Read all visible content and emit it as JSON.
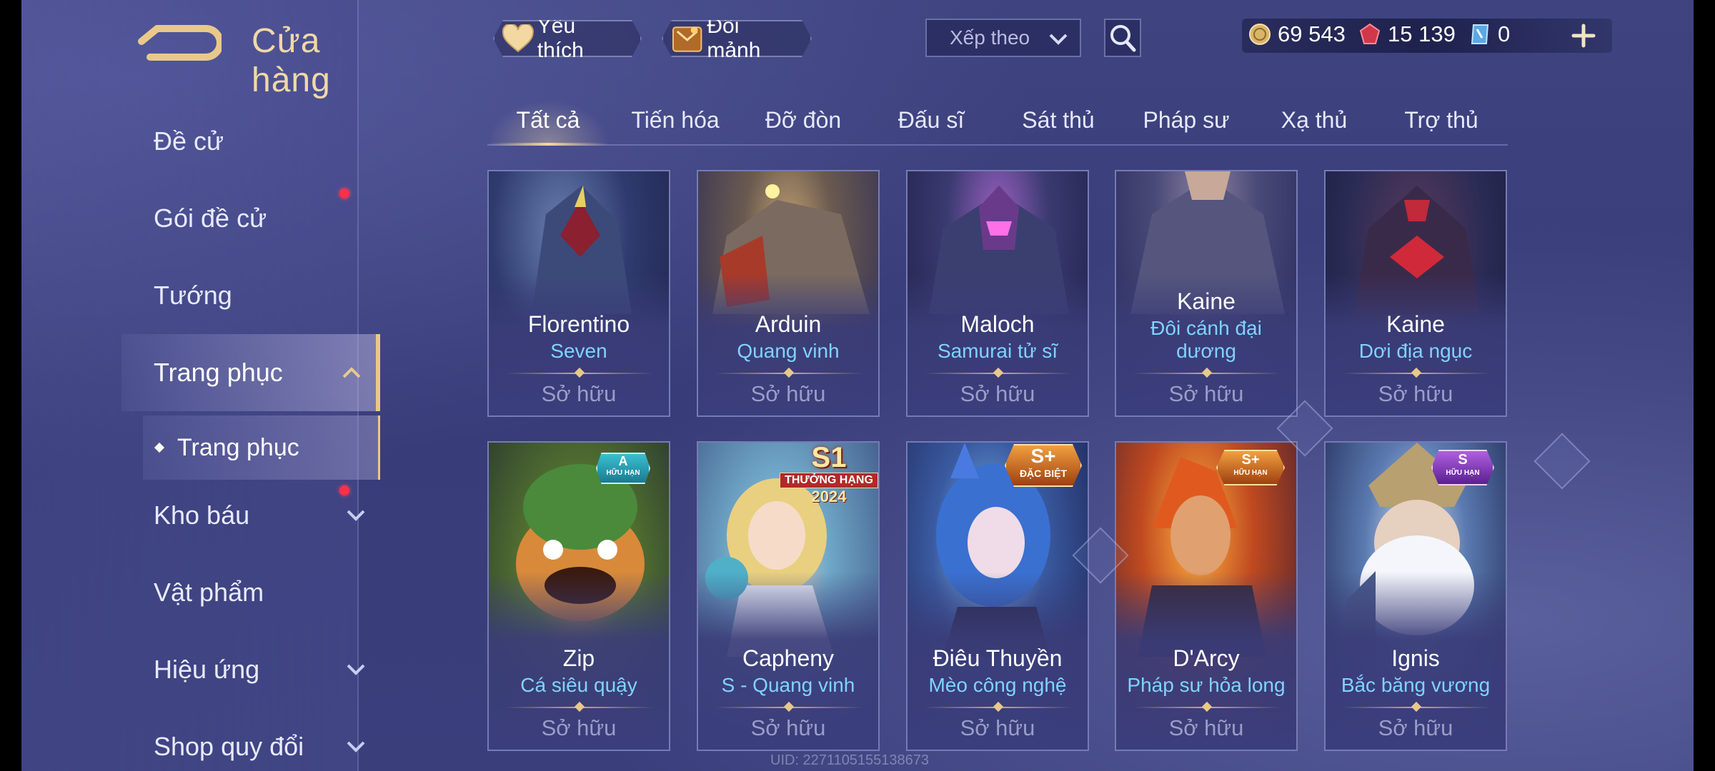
{
  "header": {
    "title": "Cửa hàng",
    "favorites_label": "Yêu thích",
    "exchange_label": "Đổi mảnh",
    "sort_label": "Xếp theo"
  },
  "currency": {
    "gold": "69 543",
    "gems": "15 139",
    "vouchers": "0"
  },
  "sidebar": {
    "items": [
      {
        "label": "Đề cử"
      },
      {
        "label": "Gói đề cử"
      },
      {
        "label": "Tướng"
      },
      {
        "label": "Trang phục"
      },
      {
        "label": "Kho báu"
      },
      {
        "label": "Vật phẩm"
      },
      {
        "label": "Hiệu ứng"
      },
      {
        "label": "Shop quy đổi"
      }
    ],
    "sub_item": "Trang phục"
  },
  "tabs": [
    "Tất cả",
    "Tiến hóa",
    "Đỡ đòn",
    "Đấu sĩ",
    "Sát thủ",
    "Pháp sư",
    "Xạ thủ",
    "Trợ thủ"
  ],
  "cards": [
    {
      "hero": "Florentino",
      "skin": "Seven",
      "status": "Sở hữu",
      "badge": ""
    },
    {
      "hero": "Arduin",
      "skin": "Quang vinh",
      "status": "Sở hữu",
      "badge": ""
    },
    {
      "hero": "Maloch",
      "skin": "Samurai tử sĩ",
      "status": "Sở hữu",
      "badge": ""
    },
    {
      "hero": "Kaine",
      "skin": "Đôi cánh đại dương",
      "skin_line1": "Đôi cánh đại",
      "skin_line2": "dương",
      "status": "Sở hữu",
      "badge": ""
    },
    {
      "hero": "Kaine",
      "skin": "Dơi địa ngục",
      "status": "Sở hữu",
      "badge": ""
    },
    {
      "hero": "Zip",
      "skin": "Cá siêu quậy",
      "status": "Sở hữu",
      "badge": "A",
      "badge_sub": "HỮU HẠN"
    },
    {
      "hero": "Capheny",
      "skin": "S - Quang vinh",
      "status": "Sở hữu",
      "badge": "S1",
      "badge_sub": "THƯỞNG HẠNG",
      "badge_year": "2024"
    },
    {
      "hero": "Điêu Thuyền",
      "skin": "Mèo công nghệ",
      "status": "Sở hữu",
      "badge": "S+",
      "badge_sub": "ĐẶC BIỆT"
    },
    {
      "hero": "D'Arcy",
      "skin": "Pháp sư hỏa long",
      "status": "Sở hữu",
      "badge": "S+",
      "badge_sub": "HỮU HẠN"
    },
    {
      "hero": "Ignis",
      "skin": "Bắc băng vương",
      "status": "Sở hữu",
      "badge": "S",
      "badge_sub": "HỮU HẠN"
    }
  ],
  "uid": "UID: 2271105155138673",
  "colors": {
    "accent_gold": "#e9c98a",
    "skin_name_blue": "#7fd3ff",
    "background": "#3a3f7c",
    "notification_red": "#ff3048"
  },
  "icons": {
    "back": "back-arrow-icon",
    "favorites": "heart-icon",
    "exchange": "shard-box-icon",
    "search": "search-icon",
    "gold": "gold-coin-icon",
    "gems": "red-gem-icon",
    "voucher": "voucher-icon",
    "add": "plus-icon"
  }
}
